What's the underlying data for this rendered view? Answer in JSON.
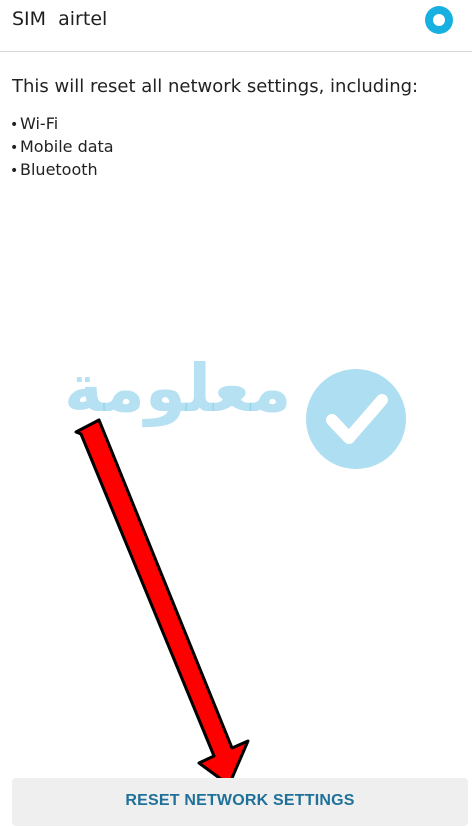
{
  "sim": {
    "label": "SIM  airtel",
    "selected": true,
    "accent_color": "#17b0e0"
  },
  "description": "This will reset all network settings, including:",
  "items": [
    {
      "bullet": "•",
      "label": "Wi-Fi"
    },
    {
      "bullet": "•",
      "label": "Mobile data"
    },
    {
      "bullet": "•",
      "label": "Bluetooth"
    }
  ],
  "watermark": {
    "text": "معلومة",
    "logo_icon": "checkmark-circle-icon",
    "color": "#78c8e8"
  },
  "annotation": {
    "icon": "red-arrow-icon",
    "color": "#ff0000"
  },
  "reset_button": {
    "label": "RESET NETWORK SETTINGS",
    "text_color": "#1f7199"
  }
}
